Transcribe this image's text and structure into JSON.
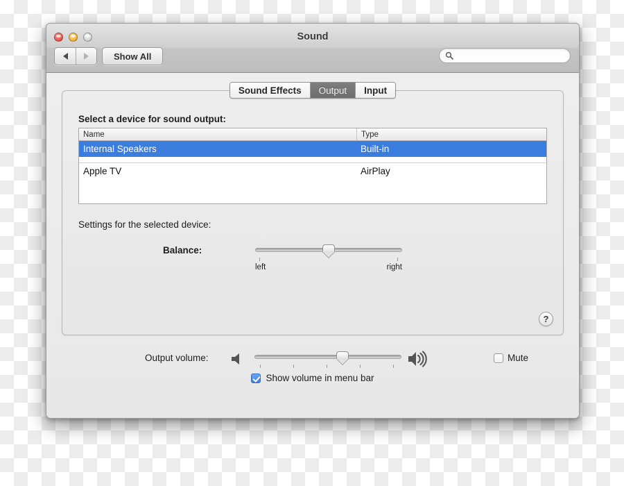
{
  "window": {
    "title": "Sound",
    "traffic_lights": [
      "close",
      "minimize",
      "zoom"
    ],
    "nav_back": "back-arrow",
    "nav_forward": "forward-arrow",
    "show_all_label": "Show All",
    "search_placeholder": "",
    "search_value": ""
  },
  "tabs": [
    {
      "label": "Sound Effects",
      "active": false
    },
    {
      "label": "Output",
      "active": true
    },
    {
      "label": "Input",
      "active": false
    }
  ],
  "panel": {
    "section_label": "Select a device for sound output:",
    "table": {
      "columns": [
        "Name",
        "Type"
      ],
      "rows": [
        {
          "name": "Internal Speakers",
          "type": "Built-in",
          "selected": true
        },
        {
          "name": "Apple TV",
          "type": "AirPlay",
          "selected": false
        }
      ]
    },
    "settings_label": "Settings for the selected device:",
    "balance": {
      "caption": "Balance:",
      "value_percent": 50,
      "tick_left_label": "left",
      "tick_right_label": "right"
    },
    "help_label": "?"
  },
  "bottom": {
    "volume_caption": "Output volume:",
    "volume_percent": 60,
    "speaker_low_icon": "speaker-icon",
    "speaker_high_icon": "speaker-waves-icon",
    "mute_label": "Mute",
    "mute_checked": false,
    "menubar_label": "Show volume in menu bar",
    "menubar_checked": true
  },
  "colors": {
    "selection_blue": "#3b7ddd",
    "checkbox_blue": "#3f7fdc",
    "active_tab_gray": "#6e6e6e"
  }
}
